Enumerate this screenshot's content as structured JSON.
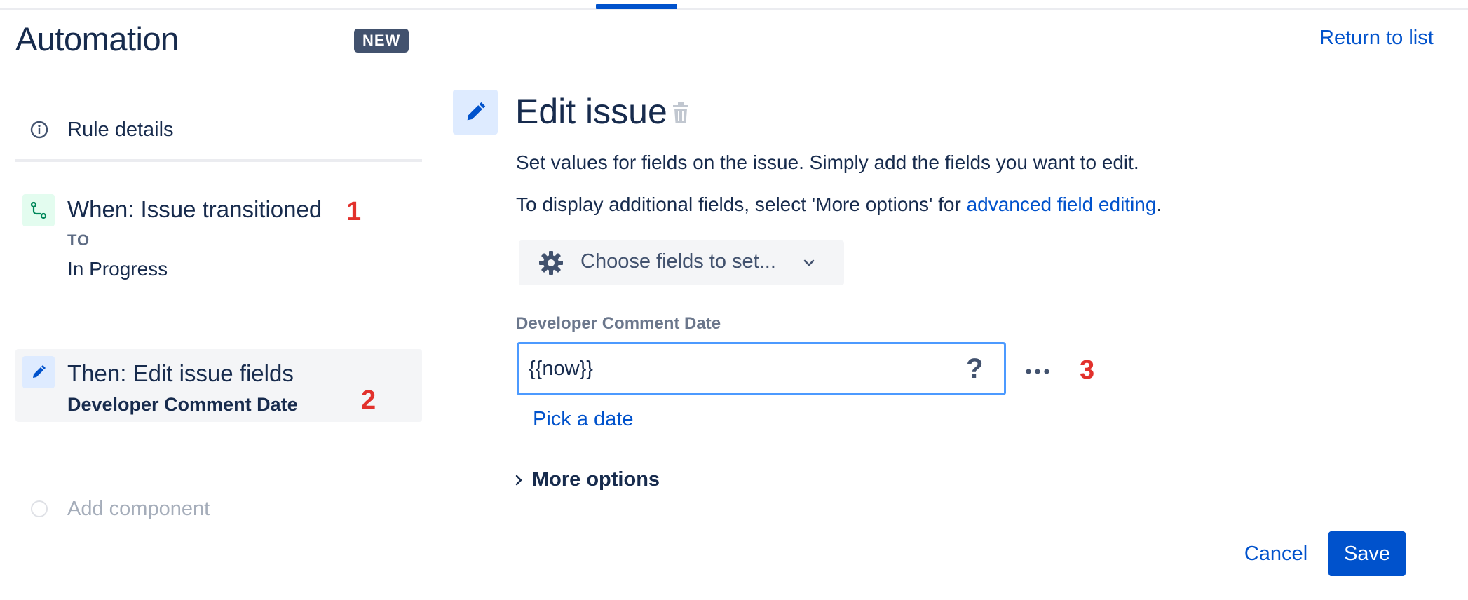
{
  "header": {
    "title": "Automation",
    "badge": "NEW",
    "return_link": "Return to list"
  },
  "sidebar": {
    "rule_details": {
      "label": "Rule details",
      "icon": "info-icon"
    },
    "trigger": {
      "icon": "trigger-branch-icon",
      "title": "When: Issue transitioned",
      "sub_label": "TO",
      "value": "In Progress",
      "annotation": "1"
    },
    "action": {
      "icon": "pencil-icon",
      "title": "Then: Edit issue fields",
      "sub_label": "Developer Comment Date",
      "annotation": "2"
    },
    "add_component": {
      "label": "Add component"
    }
  },
  "panel": {
    "icon": "pencil-icon",
    "title": "Edit issue",
    "description": "Set values for fields on the issue. Simply add the fields you want to edit.",
    "description2_prefix": "To display additional fields, select 'More options' for ",
    "description2_link": "advanced field editing",
    "description2_suffix": ".",
    "choose_fields_label": "Choose fields to set...",
    "field": {
      "label": "Developer Comment Date",
      "value": "{{now}}",
      "help": "?",
      "annotation": "3",
      "pick_date": "Pick a date"
    },
    "more_options": "More options",
    "cancel_label": "Cancel",
    "save_label": "Save"
  },
  "colors": {
    "primary": "#0052cc",
    "text": "#172b4d",
    "annotation": "#e2312c",
    "focus": "#4c9aff"
  }
}
